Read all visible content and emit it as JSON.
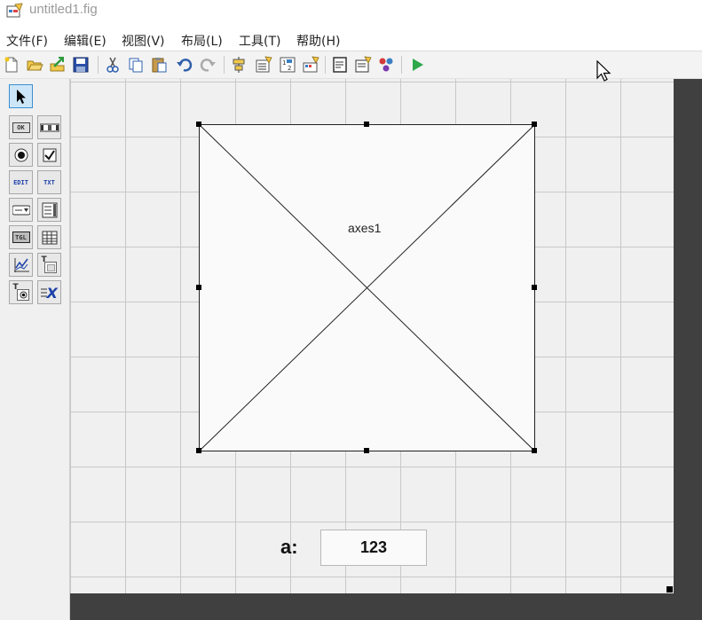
{
  "window": {
    "title": "untitled1.fig",
    "app_icon": "guide-fig-icon"
  },
  "menu": {
    "items": [
      {
        "label": "文件(F)"
      },
      {
        "label": "编辑(E)"
      },
      {
        "label": "视图(V)"
      },
      {
        "label": "布局(L)"
      },
      {
        "label": "工具(T)"
      },
      {
        "label": "帮助(H)"
      }
    ]
  },
  "toolbar": {
    "icons": [
      "new-file-icon",
      "open-folder-icon",
      "export-icon",
      "save-icon",
      "cut-icon",
      "copy-icon",
      "paste-icon",
      "undo-icon",
      "redo-icon",
      "align-objects-icon",
      "menu-editor-icon",
      "tab-order-editor-icon",
      "toolbar-editor-icon",
      "m-file-editor-icon",
      "property-inspector-icon",
      "object-browser-icon",
      "run-figure-icon"
    ]
  },
  "palette": {
    "tools": [
      {
        "name": "select-tool",
        "text": ""
      },
      {
        "name": "push-button-tool",
        "text": "OK"
      },
      {
        "name": "slider-tool",
        "text": ""
      },
      {
        "name": "radio-button-tool",
        "text": ""
      },
      {
        "name": "checkbox-tool",
        "text": ""
      },
      {
        "name": "edit-text-tool",
        "text": "EDIT"
      },
      {
        "name": "static-text-tool",
        "text": "TXT"
      },
      {
        "name": "popup-menu-tool",
        "text": ""
      },
      {
        "name": "listbox-tool",
        "text": ""
      },
      {
        "name": "toggle-button-tool",
        "text": "TGL"
      },
      {
        "name": "table-tool",
        "text": ""
      },
      {
        "name": "axes-tool",
        "text": ""
      },
      {
        "name": "panel-tool",
        "text": "T"
      },
      {
        "name": "button-group-tool",
        "text": "T"
      },
      {
        "name": "activex-control-tool",
        "text": "X"
      }
    ]
  },
  "canvas": {
    "axes": {
      "label": "axes1"
    },
    "static_label": "a:",
    "edit_value": "123"
  }
}
